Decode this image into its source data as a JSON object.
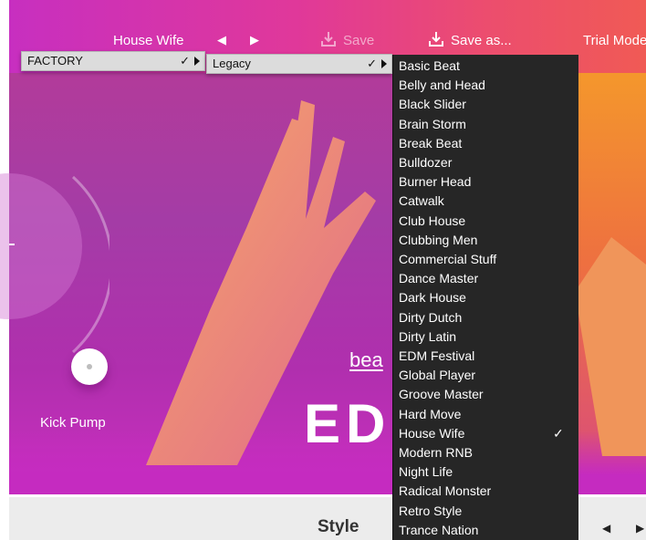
{
  "topbar": {
    "preset_name": "House Wife",
    "prev_arrow": "◀",
    "next_arrow": "▶",
    "save_label": "Save",
    "save_as_label": "Save as...",
    "trial_label": "Trial Mode"
  },
  "menus": {
    "factory": {
      "label": "FACTORY",
      "check": "✓"
    },
    "legacy": {
      "label": "Legacy",
      "check": "✓"
    }
  },
  "preset_list": {
    "items": [
      "Basic Beat",
      "Belly and Head",
      "Black Slider",
      "Brain Storm",
      "Break Beat",
      "Bulldozer",
      "Burner Head",
      "Catwalk",
      "Club House",
      "Clubbing Men",
      "Commercial Stuff",
      "Dance Master",
      "Dark House",
      "Dirty Dutch",
      "Dirty Latin",
      "EDM Festival",
      "Global Player",
      "Groove Master",
      "Hard Move",
      "House Wife",
      "Modern RNB",
      "Night Life",
      "Radical Monster",
      "Retro Style",
      "Trance Nation"
    ],
    "selected": "House Wife",
    "check": "✓"
  },
  "hero": {
    "knob_label": "Kick Pump",
    "brand_text": "bea",
    "logo_text": "ED"
  },
  "bottom": {
    "style_label": "Style",
    "prev_arrow": "◀",
    "next_arrow": "▶"
  },
  "colors": {
    "topbar_start": "#c72fc0",
    "topbar_end": "#f05a55",
    "menu_bg": "#dcdcdc",
    "list_bg": "#262626",
    "bottom_bg": "#ececec"
  }
}
